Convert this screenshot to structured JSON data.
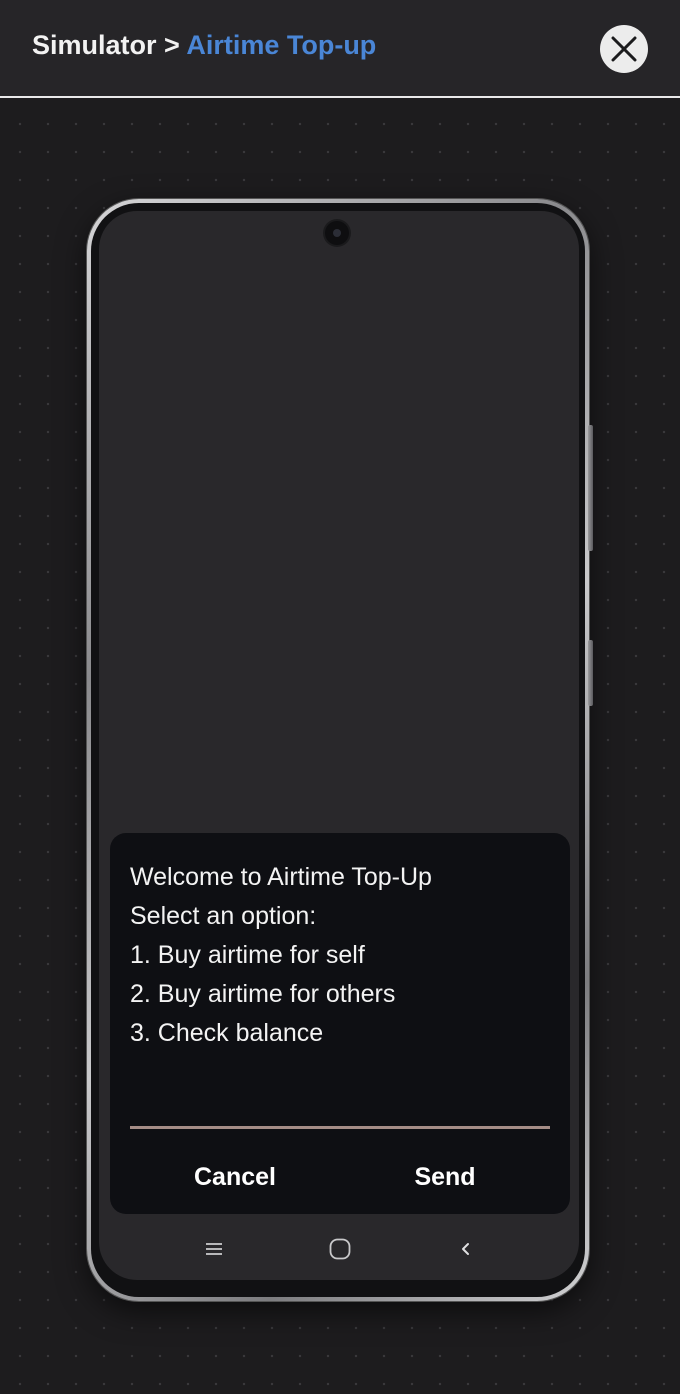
{
  "header": {
    "breadcrumb_root": "Simulator",
    "breadcrumb_separator": ">",
    "breadcrumb_current": "Airtime Top-up",
    "close_icon": "close-icon",
    "accent_color": "#4a86d6"
  },
  "ussd_dialog": {
    "lines": [
      "Welcome to Airtime Top-Up",
      "Select an option:",
      "1. Buy airtime for self",
      "2. Buy airtime for others",
      "3. Check balance"
    ],
    "input_value": "",
    "cancel_label": "Cancel",
    "send_label": "Send"
  },
  "nav_bar": {
    "recent_apps_icon": "menu-icon",
    "home_icon": "home-icon",
    "back_icon": "back-icon"
  }
}
